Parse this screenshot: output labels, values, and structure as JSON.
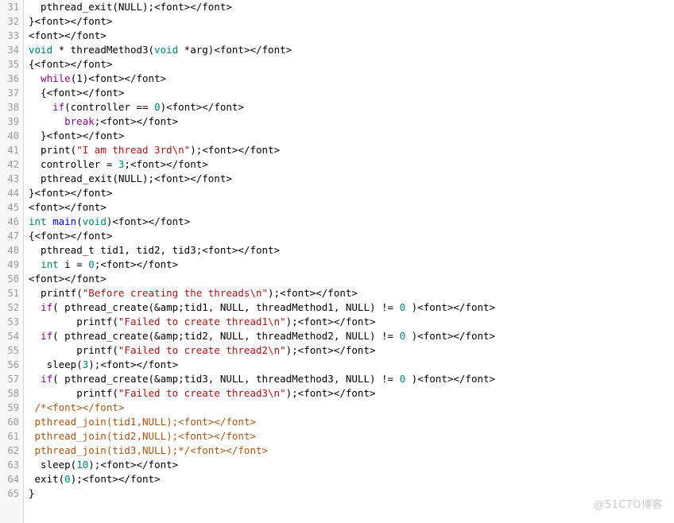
{
  "viewer": {
    "name": "code-listing",
    "language": "c",
    "first_line": 31,
    "last_line": 65,
    "colors": {
      "background": "#ffffff",
      "gutter_background": "#f7f7f7",
      "gutter_border": "#d8d8d8",
      "line_number": "#999999",
      "text": "#000000",
      "keyword": "#7f0a7f",
      "type": "#008272",
      "function": "#0000ff",
      "string": "#a31515",
      "number": "#008272",
      "comment": "#a85416",
      "watermark": "#c9c9c9"
    }
  },
  "watermark": {
    "text": "@51CTO博客"
  },
  "lines": [
    {
      "number": "31",
      "tokens": [
        {
          "text": "  pthread_exit(NULL);",
          "cls": "t-plain"
        },
        {
          "text": "<font></font>",
          "cls": "t-plain"
        }
      ]
    },
    {
      "number": "32",
      "tokens": [
        {
          "text": "}",
          "cls": "t-plain"
        },
        {
          "text": "<font></font>",
          "cls": "t-plain"
        }
      ]
    },
    {
      "number": "33",
      "tokens": [
        {
          "text": "<font></font>",
          "cls": "t-plain"
        }
      ]
    },
    {
      "number": "34",
      "tokens": [
        {
          "text": "void",
          "cls": "t-type"
        },
        {
          "text": " * threadMethod3(",
          "cls": "t-plain"
        },
        {
          "text": "void",
          "cls": "t-type"
        },
        {
          "text": " *arg)",
          "cls": "t-plain"
        },
        {
          "text": "<font></font>",
          "cls": "t-plain"
        }
      ]
    },
    {
      "number": "35",
      "tokens": [
        {
          "text": "{",
          "cls": "t-plain"
        },
        {
          "text": "<font></font>",
          "cls": "t-plain"
        }
      ]
    },
    {
      "number": "36",
      "tokens": [
        {
          "text": "  ",
          "cls": "t-plain"
        },
        {
          "text": "while",
          "cls": "t-kw"
        },
        {
          "text": "(1)",
          "cls": "t-plain"
        },
        {
          "text": "<font></font>",
          "cls": "t-plain"
        }
      ]
    },
    {
      "number": "37",
      "tokens": [
        {
          "text": "  {",
          "cls": "t-plain"
        },
        {
          "text": "<font></font>",
          "cls": "t-plain"
        }
      ]
    },
    {
      "number": "38",
      "tokens": [
        {
          "text": "    ",
          "cls": "t-plain"
        },
        {
          "text": "if",
          "cls": "t-kw"
        },
        {
          "text": "(controller == ",
          "cls": "t-plain"
        },
        {
          "text": "0",
          "cls": "t-num"
        },
        {
          "text": ")",
          "cls": "t-plain"
        },
        {
          "text": "<font></font>",
          "cls": "t-plain"
        }
      ]
    },
    {
      "number": "39",
      "tokens": [
        {
          "text": "      ",
          "cls": "t-plain"
        },
        {
          "text": "break",
          "cls": "t-kw"
        },
        {
          "text": ";",
          "cls": "t-plain"
        },
        {
          "text": "<font></font>",
          "cls": "t-plain"
        }
      ]
    },
    {
      "number": "40",
      "tokens": [
        {
          "text": "  }",
          "cls": "t-plain"
        },
        {
          "text": "<font></font>",
          "cls": "t-plain"
        }
      ]
    },
    {
      "number": "41",
      "tokens": [
        {
          "text": "  print(",
          "cls": "t-plain"
        },
        {
          "text": "\"I am thread 3rd\\n\"",
          "cls": "t-str"
        },
        {
          "text": ");",
          "cls": "t-plain"
        },
        {
          "text": "<font></font>",
          "cls": "t-plain"
        }
      ]
    },
    {
      "number": "42",
      "tokens": [
        {
          "text": "  controller = ",
          "cls": "t-plain"
        },
        {
          "text": "3",
          "cls": "t-num"
        },
        {
          "text": ";",
          "cls": "t-plain"
        },
        {
          "text": "<font></font>",
          "cls": "t-plain"
        }
      ]
    },
    {
      "number": "43",
      "tokens": [
        {
          "text": "  pthread_exit(NULL);",
          "cls": "t-plain"
        },
        {
          "text": "<font></font>",
          "cls": "t-plain"
        }
      ]
    },
    {
      "number": "44",
      "tokens": [
        {
          "text": "}",
          "cls": "t-plain"
        },
        {
          "text": "<font></font>",
          "cls": "t-plain"
        }
      ]
    },
    {
      "number": "45",
      "tokens": [
        {
          "text": "<font></font>",
          "cls": "t-plain"
        }
      ]
    },
    {
      "number": "46",
      "tokens": [
        {
          "text": "int",
          "cls": "t-type"
        },
        {
          "text": " ",
          "cls": "t-plain"
        },
        {
          "text": "main",
          "cls": "t-fn"
        },
        {
          "text": "(",
          "cls": "t-plain"
        },
        {
          "text": "void",
          "cls": "t-type"
        },
        {
          "text": ")",
          "cls": "t-plain"
        },
        {
          "text": "<font></font>",
          "cls": "t-plain"
        }
      ]
    },
    {
      "number": "47",
      "tokens": [
        {
          "text": "{",
          "cls": "t-plain"
        },
        {
          "text": "<font></font>",
          "cls": "t-plain"
        }
      ]
    },
    {
      "number": "48",
      "tokens": [
        {
          "text": "  pthread_t tid1, tid2, tid3;",
          "cls": "t-plain"
        },
        {
          "text": "<font></font>",
          "cls": "t-plain"
        }
      ]
    },
    {
      "number": "49",
      "tokens": [
        {
          "text": "  ",
          "cls": "t-plain"
        },
        {
          "text": "int",
          "cls": "t-type"
        },
        {
          "text": " i = ",
          "cls": "t-plain"
        },
        {
          "text": "0",
          "cls": "t-num"
        },
        {
          "text": ";",
          "cls": "t-plain"
        },
        {
          "text": "<font></font>",
          "cls": "t-plain"
        }
      ]
    },
    {
      "number": "50",
      "tokens": [
        {
          "text": "<font></font>",
          "cls": "t-plain"
        }
      ]
    },
    {
      "number": "51",
      "tokens": [
        {
          "text": "  printf(",
          "cls": "t-plain"
        },
        {
          "text": "\"Before creating the threads\\n\"",
          "cls": "t-str"
        },
        {
          "text": ");",
          "cls": "t-plain"
        },
        {
          "text": "<font></font>",
          "cls": "t-plain"
        }
      ]
    },
    {
      "number": "52",
      "tokens": [
        {
          "text": "  ",
          "cls": "t-plain"
        },
        {
          "text": "if",
          "cls": "t-kw"
        },
        {
          "text": "( pthread_create(&amp;tid1, NULL, threadMethod1, NULL) != ",
          "cls": "t-plain"
        },
        {
          "text": "0",
          "cls": "t-num"
        },
        {
          "text": " )",
          "cls": "t-plain"
        },
        {
          "text": "<font></font>",
          "cls": "t-plain"
        }
      ]
    },
    {
      "number": "53",
      "tokens": [
        {
          "text": "        printf(",
          "cls": "t-plain"
        },
        {
          "text": "\"Failed to create thread1\\n\"",
          "cls": "t-str"
        },
        {
          "text": ");",
          "cls": "t-plain"
        },
        {
          "text": "<font></font>",
          "cls": "t-plain"
        }
      ]
    },
    {
      "number": "54",
      "tokens": [
        {
          "text": "  ",
          "cls": "t-plain"
        },
        {
          "text": "if",
          "cls": "t-kw"
        },
        {
          "text": "( pthread_create(&amp;tid2, NULL, threadMethod2, NULL) != ",
          "cls": "t-plain"
        },
        {
          "text": "0",
          "cls": "t-num"
        },
        {
          "text": " )",
          "cls": "t-plain"
        },
        {
          "text": "<font></font>",
          "cls": "t-plain"
        }
      ]
    },
    {
      "number": "55",
      "tokens": [
        {
          "text": "        printf(",
          "cls": "t-plain"
        },
        {
          "text": "\"Failed to create thread2\\n\"",
          "cls": "t-str"
        },
        {
          "text": ");",
          "cls": "t-plain"
        },
        {
          "text": "<font></font>",
          "cls": "t-plain"
        }
      ]
    },
    {
      "number": "56",
      "tokens": [
        {
          "text": "   sleep(",
          "cls": "t-plain"
        },
        {
          "text": "3",
          "cls": "t-num"
        },
        {
          "text": ");",
          "cls": "t-plain"
        },
        {
          "text": "<font></font>",
          "cls": "t-plain"
        }
      ]
    },
    {
      "number": "57",
      "tokens": [
        {
          "text": "  ",
          "cls": "t-plain"
        },
        {
          "text": "if",
          "cls": "t-kw"
        },
        {
          "text": "( pthread_create(&amp;tid3, NULL, threadMethod3, NULL) != ",
          "cls": "t-plain"
        },
        {
          "text": "0",
          "cls": "t-num"
        },
        {
          "text": " )",
          "cls": "t-plain"
        },
        {
          "text": "<font></font>",
          "cls": "t-plain"
        }
      ]
    },
    {
      "number": "58",
      "tokens": [
        {
          "text": "        printf(",
          "cls": "t-plain"
        },
        {
          "text": "\"Failed to create thread3\\n\"",
          "cls": "t-str"
        },
        {
          "text": ");",
          "cls": "t-plain"
        },
        {
          "text": "<font></font>",
          "cls": "t-plain"
        }
      ]
    },
    {
      "number": "59",
      "tokens": [
        {
          "text": " /*",
          "cls": "t-cmt"
        },
        {
          "text": "<font></font>",
          "cls": "t-cmt"
        }
      ]
    },
    {
      "number": "60",
      "tokens": [
        {
          "text": " pthread_join(tid1,NULL);",
          "cls": "t-cmt"
        },
        {
          "text": "<font></font>",
          "cls": "t-cmt"
        }
      ]
    },
    {
      "number": "61",
      "tokens": [
        {
          "text": " pthread_join(tid2,NULL);",
          "cls": "t-cmt"
        },
        {
          "text": "<font></font>",
          "cls": "t-cmt"
        }
      ]
    },
    {
      "number": "62",
      "tokens": [
        {
          "text": " pthread_join(tid3,NULL);*/",
          "cls": "t-cmt"
        },
        {
          "text": "<font></font>",
          "cls": "t-cmt"
        }
      ]
    },
    {
      "number": "63",
      "tokens": [
        {
          "text": "  sleep(",
          "cls": "t-plain"
        },
        {
          "text": "10",
          "cls": "t-num"
        },
        {
          "text": ");",
          "cls": "t-plain"
        },
        {
          "text": "<font></font>",
          "cls": "t-plain"
        }
      ]
    },
    {
      "number": "64",
      "tokens": [
        {
          "text": " exit(",
          "cls": "t-plain"
        },
        {
          "text": "0",
          "cls": "t-num"
        },
        {
          "text": ");",
          "cls": "t-plain"
        },
        {
          "text": "<font></font>",
          "cls": "t-plain"
        }
      ]
    },
    {
      "number": "65",
      "tokens": [
        {
          "text": "}",
          "cls": "t-plain"
        }
      ]
    }
  ]
}
